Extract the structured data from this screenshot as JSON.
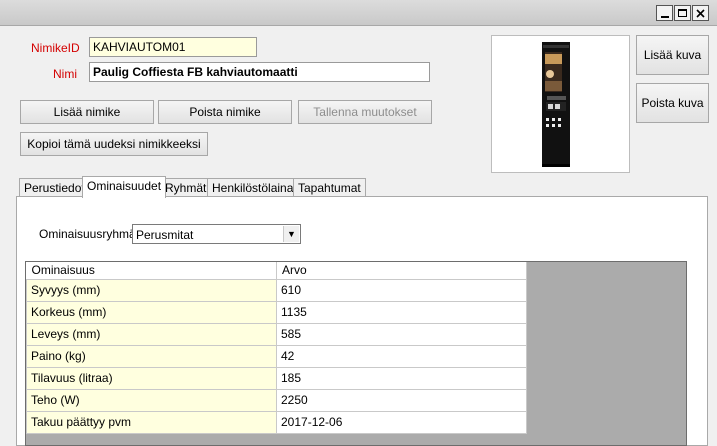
{
  "window": {
    "minimize_icon": "minimize-icon",
    "maximize_icon": "maximize-icon",
    "close_icon": "close-icon"
  },
  "header": {
    "id_label": "NimikeID",
    "id_value": "KAHVIAUTOM01",
    "name_label": "Nimi",
    "name_value": "Paulig Coffiesta FB kahviautomaatti"
  },
  "buttons": {
    "add_item": "Lisää nimike",
    "delete_item": "Poista nimike",
    "save_changes": "Tallenna muutokset",
    "copy_new": "Kopioi tämä uudeksi nimikkeeksi",
    "add_image": "Lisää kuva",
    "delete_image": "Poista kuva"
  },
  "tabs": [
    {
      "label": "Perustiedot",
      "active": false
    },
    {
      "label": "Ominaisuudet",
      "active": true
    },
    {
      "label": "Ryhmät",
      "active": false
    },
    {
      "label": "Henkilöstölainat",
      "active": false
    },
    {
      "label": "Tapahtumat",
      "active": false
    }
  ],
  "properties": {
    "group_label": "Ominaisuusryhmä",
    "group_selected": "Perusmitat",
    "columns": [
      "Ominaisuus",
      "Arvo"
    ],
    "rows": [
      {
        "name": "Syvyys (mm)",
        "value": "610"
      },
      {
        "name": "Korkeus (mm)",
        "value": "1135"
      },
      {
        "name": "Leveys (mm)",
        "value": "585"
      },
      {
        "name": "Paino (kg)",
        "value": "42"
      },
      {
        "name": "Tilavuus (litraa)",
        "value": "185"
      },
      {
        "name": "Teho (W)",
        "value": "2250"
      },
      {
        "name": "Takuu päättyy pvm",
        "value": "2017-12-06"
      }
    ]
  }
}
